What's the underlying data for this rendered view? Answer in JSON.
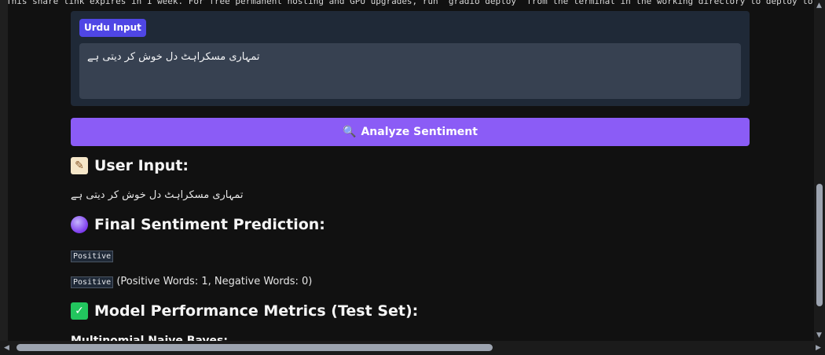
{
  "banner": {
    "notice": "This share link expires in 1 week. For free permanent hosting and GPU upgrades, run `gradio deploy` from the terminal in the working directory to deploy to Hugging Face Spaces."
  },
  "input": {
    "label": "Urdu Input",
    "value": "تمہاری مسکراہٹ دل خوش کر دیتی ہے"
  },
  "analyze_button": {
    "icon": "magnifier-icon",
    "label": "Analyze Sentiment"
  },
  "results": {
    "user_input_heading": "User Input:",
    "user_input_text": "تمہاری مسکراہٹ دل خوش کر دیتی ہے",
    "final_heading": "Final Sentiment Prediction:",
    "final_label": "Positive",
    "lexicon_label": "Positive",
    "lexicon_detail": "(Positive Words: 1, Negative Words: 0)",
    "metrics_heading": "Model Performance Metrics (Test Set):",
    "first_model": "Multinomial Naive Bayes:"
  },
  "colors": {
    "page_bg": "#111111",
    "card_bg": "#1f2937",
    "label_bg": "#4f46e5",
    "button_bg": "#8b5cf6"
  }
}
